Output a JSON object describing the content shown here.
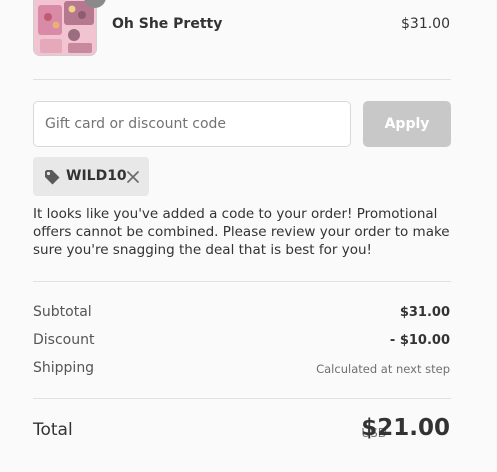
{
  "product": {
    "name": "Oh She Pretty",
    "price": "$31.00",
    "thumbnail_icon": "eyeshadow-palette-image"
  },
  "discount": {
    "placeholder": "Gift card or discount code",
    "value": "",
    "apply_label": "Apply",
    "applied_code": "WILD10",
    "notice": "It looks like you've added a code to your order! Promotional offers cannot be combined. Please review your order to make sure you're snagging the deal that is best for you!"
  },
  "summary": {
    "subtotal_label": "Subtotal",
    "subtotal_value": "$31.00",
    "discount_label": "Discount",
    "discount_value": "- $10.00",
    "shipping_label": "Shipping",
    "shipping_value": "Calculated at next step"
  },
  "total": {
    "label": "Total",
    "currency": "USD",
    "amount": "$21.00"
  },
  "colors": {
    "background": "#fafafa",
    "apply_disabled": "#c8c8c8",
    "tag_background": "#e8e8e8",
    "text": "#333333"
  }
}
